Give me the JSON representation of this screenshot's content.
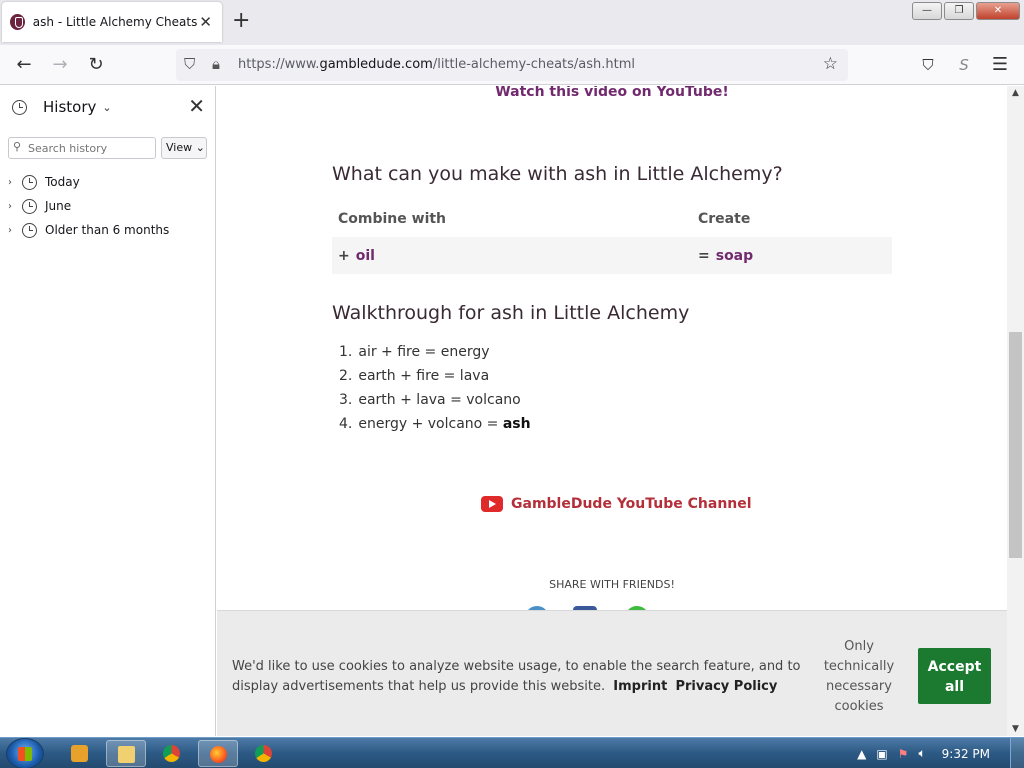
{
  "browser": {
    "tab_title": "ash - Little Alchemy Cheats",
    "url_prefix": "https://www.",
    "url_domain": "gambledude.com",
    "url_path": "/little-alchemy-cheats/ash.html"
  },
  "sidebar": {
    "title": "History",
    "search_placeholder": "Search history",
    "view_label": "View",
    "items": [
      {
        "label": "Today"
      },
      {
        "label": "June"
      },
      {
        "label": "Older than 6 months"
      }
    ]
  },
  "page": {
    "watch_link": "Watch this video on YouTube!",
    "make_heading": "What can you make with ash in Little Alchemy?",
    "table": {
      "col_combine": "Combine with",
      "col_create": "Create",
      "rows": [
        {
          "op1": "+",
          "combine": "oil",
          "op2": "=",
          "create": "soap"
        }
      ]
    },
    "walk_heading": "Walkthrough for ash in Little Alchemy",
    "steps": [
      {
        "num": "1.",
        "text": "air + fire = energy",
        "bold": ""
      },
      {
        "num": "2.",
        "text": "earth + fire = lava",
        "bold": ""
      },
      {
        "num": "3.",
        "text": "earth + lava = volcano",
        "bold": ""
      },
      {
        "num": "4.",
        "text": "energy + volcano = ",
        "bold": "ash"
      }
    ],
    "youtube_channel": "GambleDude YouTube Channel",
    "share_label": "SHARE WITH FRIENDS!"
  },
  "cookie": {
    "text": "We'd like to use cookies to analyze website usage, to enable the search feature, and to display advertisements that help us provide this website.",
    "imprint": "Imprint",
    "privacy": "Privacy Policy",
    "only_necessary": "Only technically necessary cookies",
    "accept": "Accept all"
  },
  "taskbar": {
    "time": "9:32 PM"
  },
  "colors": {
    "accent": "#722a6e",
    "accept_green": "#1b7a2f",
    "youtube_red": "#e02a2a"
  }
}
